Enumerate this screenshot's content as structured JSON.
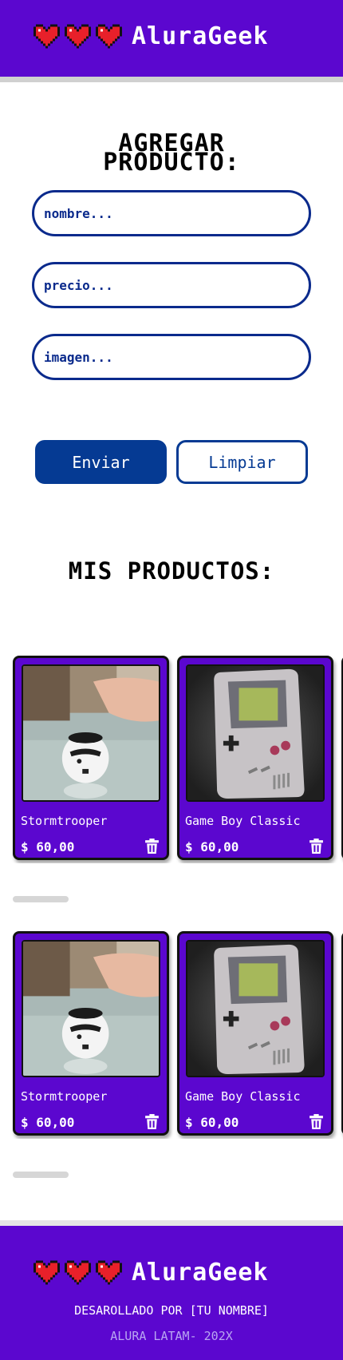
{
  "header": {
    "brand": "AluraGeek",
    "hearts": [
      "heart-icon",
      "heart-icon",
      "heart-icon"
    ]
  },
  "form": {
    "title": "AGREGAR PRODUCTO:",
    "name_placeholder": "nombre...",
    "price_placeholder": "precio...",
    "image_placeholder": "imagen...",
    "submit_label": "Enviar",
    "clear_label": "Limpiar"
  },
  "products": {
    "title": "MIS PRODUCTOS:",
    "rows": [
      {
        "items": [
          {
            "name": "Stormtrooper",
            "price": "$ 60,00",
            "image": "stormtrooper-mug",
            "delete_icon": "trash-icon"
          },
          {
            "name": "Game Boy Classic",
            "price": "$ 60,00",
            "image": "game-boy-console",
            "delete_icon": "trash-icon"
          }
        ]
      },
      {
        "items": [
          {
            "name": "Stormtrooper",
            "price": "$ 60,00",
            "image": "stormtrooper-mug",
            "delete_icon": "trash-icon"
          },
          {
            "name": "Game Boy Classic",
            "price": "$ 60,00",
            "image": "game-boy-console",
            "delete_icon": "trash-icon"
          }
        ]
      }
    ]
  },
  "footer": {
    "brand": "AluraGeek",
    "developer": "DESAROLLADO POR [TU NOMBRE]",
    "copyright": "ALURA LATAM- 202X"
  },
  "colors": {
    "primary": "#5b07cf",
    "accent_blue": "#053a93",
    "field_border": "#0a2a8c"
  }
}
